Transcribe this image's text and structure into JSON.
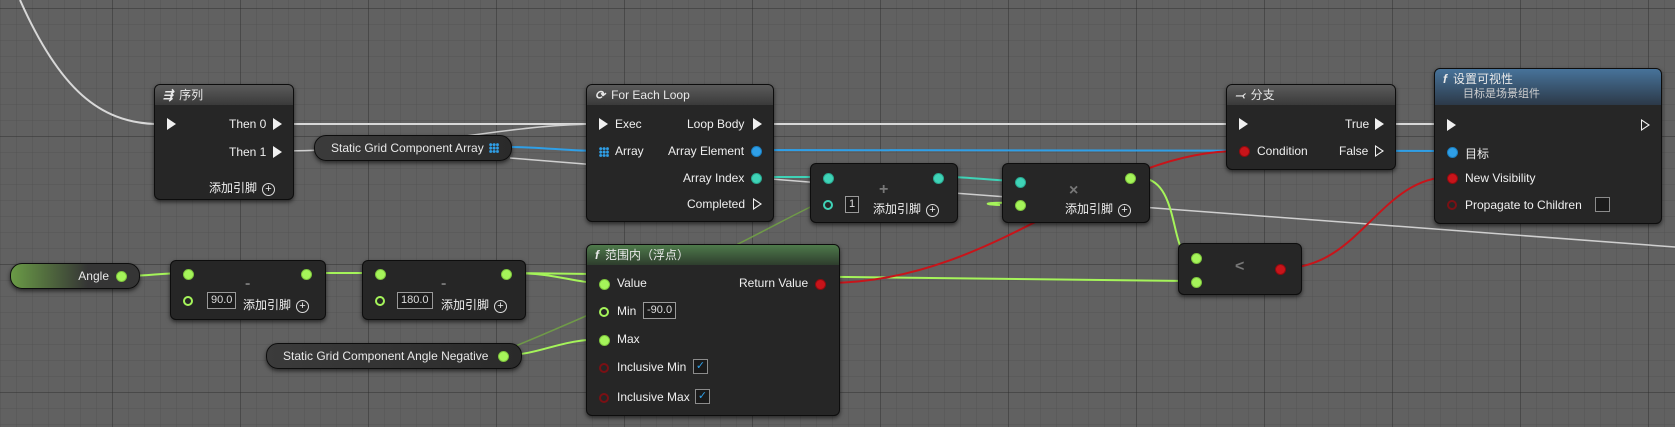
{
  "colors": {
    "exec": "#f0f0f0",
    "float": "#a5f45a",
    "int": "#3fd3b7",
    "object": "#2f9fe7",
    "bool": "#c8141a",
    "graph_bg": "#616161",
    "node_bg": "#262626"
  },
  "sequence": {
    "title": "序列",
    "then0": "Then 0",
    "then1": "Then 1",
    "add_pin": "添加引脚"
  },
  "for_each": {
    "title": "For Each Loop",
    "exec": "Exec",
    "array": "Array",
    "loop_body": "Loop Body",
    "array_element": "Array Element",
    "array_index": "Array Index",
    "completed": "Completed"
  },
  "branch": {
    "title": "分支",
    "condition": "Condition",
    "true": "True",
    "false": "False"
  },
  "set_visibility": {
    "title": "设置可视性",
    "subtitle": "目标是场景组件",
    "target": "目标",
    "new_visibility": "New Visibility",
    "propagate": "Propagate to Children"
  },
  "variables": {
    "grid_array": "Static Grid Component Array",
    "angle": "Angle",
    "angle_negative": "Static Grid Component Angle Negative"
  },
  "add_node": {
    "operator": "+",
    "value": "1",
    "add_pin": "添加引脚"
  },
  "multiply_node": {
    "operator": "×",
    "add_pin": "添加引脚"
  },
  "subtract_node_1": {
    "operator": "-",
    "value": "90.0",
    "add_pin": "添加引脚"
  },
  "subtract_node_2": {
    "operator": "-",
    "value": "180.0",
    "add_pin": "添加引脚"
  },
  "in_range": {
    "title": "范围内（浮点）",
    "value": "Value",
    "min": "Min",
    "min_value": "-90.0",
    "max": "Max",
    "inclusive_min": "Inclusive Min",
    "inclusive_max": "Inclusive Max",
    "return_value": "Return Value",
    "inclusive_min_checked": true,
    "inclusive_max_checked": true
  },
  "less_node": {
    "operator": "<"
  }
}
